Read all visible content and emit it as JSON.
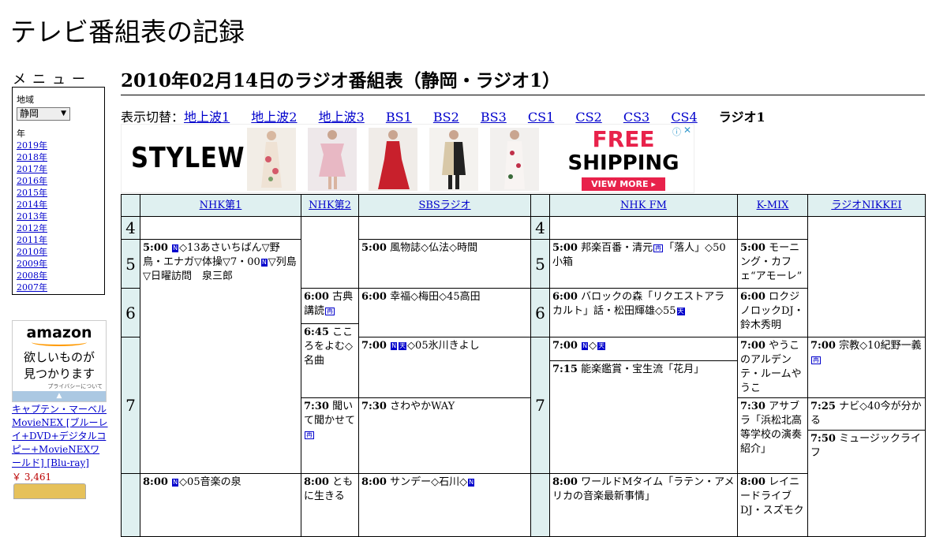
{
  "site_title": "テレビ番組表の記録",
  "menu": {
    "heading": "メニュー",
    "region_label": "地域",
    "region_value": "静岡",
    "year_label": "年",
    "years": [
      "2019年",
      "2018年",
      "2017年",
      "2016年",
      "2015年",
      "2014年",
      "2013年",
      "2012年",
      "2011年",
      "2010年",
      "2009年",
      "2008年",
      "2007年"
    ]
  },
  "amazon_ad": {
    "logo": "amazon",
    "text_line1": "欲しいものが",
    "text_line2": "見つかります",
    "privacy": "プライバシーについて",
    "product_title": "キャプテン・マーベル MovieNEX [ブルーレイ+DVD+デジタルコピー+MovieNEXワールド] [Blu-ray]",
    "price": "￥ 3,461"
  },
  "page_heading": "2010年02月14日のラジオ番組表（静岡・ラジオ1）",
  "channel_switch": {
    "label": "表示切替：",
    "links": [
      "地上波1",
      "地上波2",
      "地上波3",
      "BS1",
      "BS2",
      "BS3",
      "CS1",
      "CS2",
      "CS3",
      "CS4"
    ],
    "current": "ラジオ1"
  },
  "stylewe_ad": {
    "brand": "STYLEWE",
    "free": "FREE",
    "shipping": "SHIPPING",
    "view_more": "VIEW MORE ▸",
    "info": "ⓘ",
    "close": "✕"
  },
  "schedule": {
    "channels": [
      "NHK第1",
      "NHK第2",
      "SBSラジオ",
      "NHK FM",
      "K-MIX",
      "ラジオNIKKEI"
    ],
    "hours": [
      "4",
      "5",
      "6",
      "7"
    ],
    "programs": {
      "nhk1_500": {
        "time": "5:00",
        "text": "◇13あさいちばん▽野鳥・エナガ▽体操▽7・00",
        "text2": "▽列島▽日曜訪問　泉三郎"
      },
      "nhk1_800": {
        "time": "8:00",
        "text": "◇05音楽の泉"
      },
      "nhk2_600": {
        "time": "6:00",
        "text": "古典講読"
      },
      "nhk2_645": {
        "time": "6:45",
        "text": "こころをよむ◇名曲"
      },
      "nhk2_730": {
        "time": "7:30",
        "text": "聞いて聞かせて"
      },
      "nhk2_800": {
        "time": "8:00",
        "text": "ともに生きる"
      },
      "sbs_500": {
        "time": "5:00",
        "text": "風物誌◇仏法◇時間"
      },
      "sbs_600": {
        "time": "6:00",
        "text": "幸福◇梅田◇45高田"
      },
      "sbs_700": {
        "time": "7:00",
        "text": "◇05氷川きよし"
      },
      "sbs_730": {
        "time": "7:30",
        "text": "さわやかWAY"
      },
      "sbs_800": {
        "time": "8:00",
        "text": "サンデー◇石川◇"
      },
      "fm_500": {
        "time": "5:00",
        "text": "邦楽百番・清元",
        "text2": "「落人」◇50小箱"
      },
      "fm_600": {
        "time": "6:00",
        "text": "バロックの森「リクエストアラカルト」話・松田輝雄◇55"
      },
      "fm_700": {
        "time": "7:00",
        "text": "◇"
      },
      "fm_715": {
        "time": "7:15",
        "text": "能楽鑑賞・宝生流「花月」"
      },
      "fm_800": {
        "time": "8:00",
        "text": "ワールドMタイム「ラテン・アメリカの音楽最新事情」"
      },
      "kmix_500": {
        "time": "5:00",
        "text": "モーニング・カフェ“アモーレ”"
      },
      "kmix_600": {
        "time": "6:00",
        "text": "ロクジノロックDJ・鈴木秀明"
      },
      "kmix_700": {
        "time": "7:00",
        "text": "やうこのアルデンテ・ルームやうこ"
      },
      "kmix_730": {
        "time": "7:30",
        "text": "アサブラ「浜松北高等学校の演奏紹介」"
      },
      "kmix_800": {
        "time": "8:00",
        "text": "レイニードライブDJ・スズモク"
      },
      "nikkei_700": {
        "time": "7:00",
        "text": "宗教◇10紀野一義"
      },
      "nikkei_725": {
        "time": "7:25",
        "text": "ナビ◇40今が分かる"
      },
      "nikkei_750": {
        "time": "7:50",
        "text": "ミュージックライフ"
      }
    },
    "badges": {
      "n": "N",
      "ten": "天",
      "sai": "再",
      "n2": "N"
    }
  },
  "colors": {
    "header_bg": "#dff0f0",
    "link": "#0000cc",
    "ad_red": "#e8224b"
  }
}
